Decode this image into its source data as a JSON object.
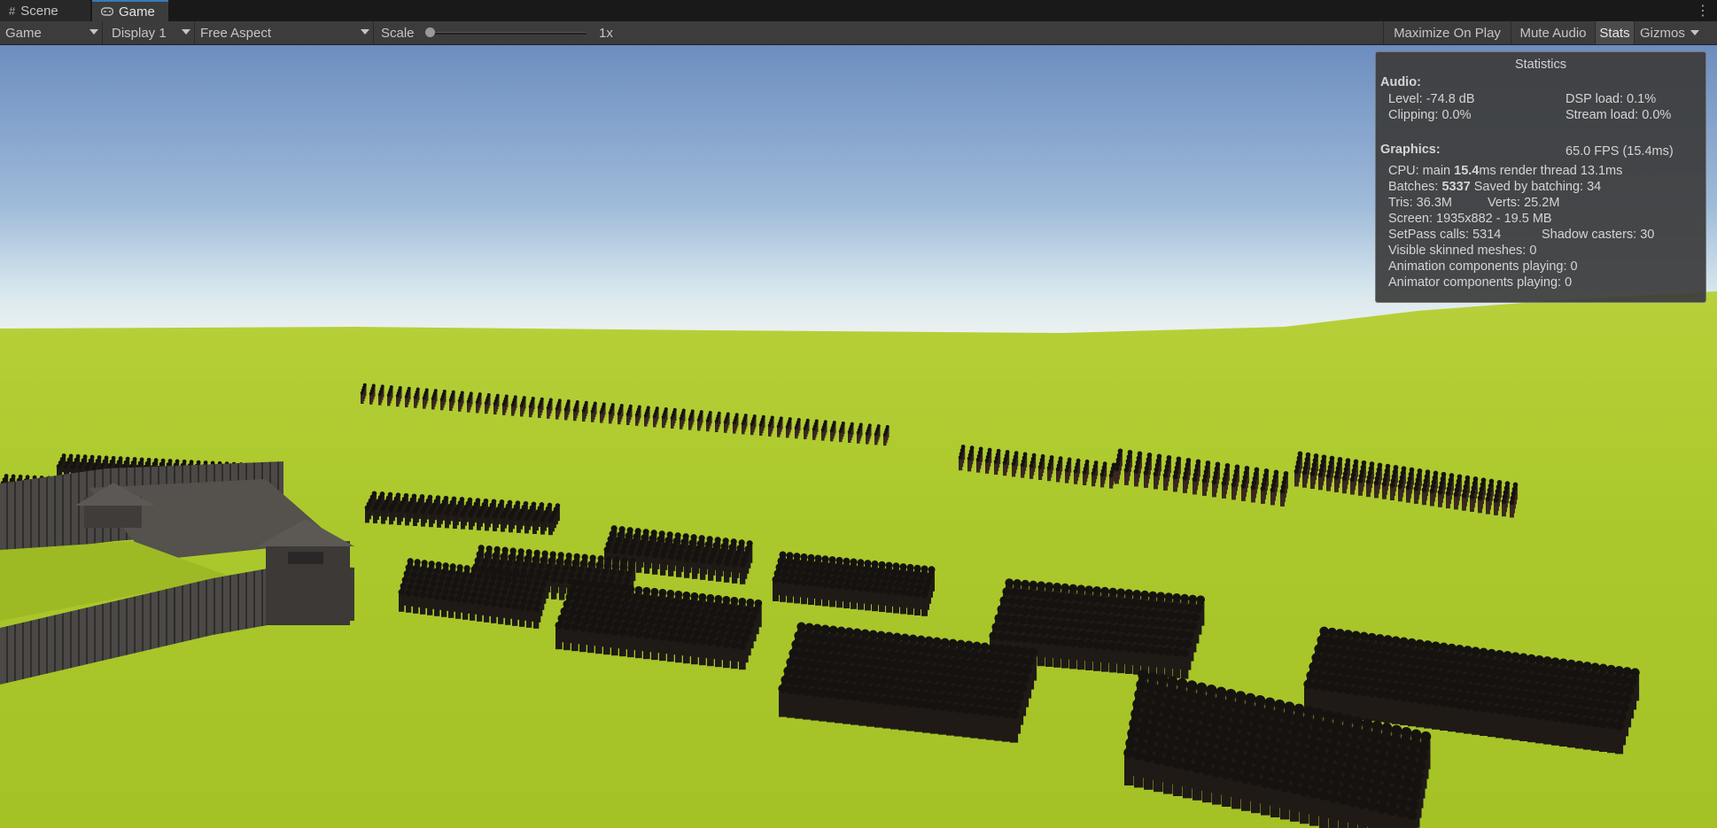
{
  "tabs": [
    {
      "label": "Scene",
      "icon": "grid-icon"
    },
    {
      "label": "Game",
      "icon": "gamepad-icon"
    }
  ],
  "toolbar": {
    "mode": "Game",
    "display": "Display 1",
    "aspect": "Free Aspect",
    "scale_label": "Scale",
    "scale_value": "1x",
    "scale_fraction": 0.0,
    "maximize": "Maximize On Play",
    "mute": "Mute Audio",
    "stats": "Stats",
    "gizmos": "Gizmos"
  },
  "stats": {
    "title": "Statistics",
    "audio_header": "Audio:",
    "level": "Level: -74.8 dB",
    "dsp": "DSP load: 0.1%",
    "clipping": "Clipping: 0.0%",
    "stream": "Stream load: 0.0%",
    "graphics_header": "Graphics:",
    "fps": "65.0 FPS (15.4ms)",
    "cpu_prefix": "CPU: main ",
    "cpu_main": "15.4",
    "cpu_suffix": "ms  render thread 13.1ms",
    "batches_prefix": "Batches: ",
    "batches": "5337",
    "batches_suffix": "  Saved by batching: 34",
    "tris": "Tris: 36.3M",
    "verts": "Verts: 25.2M",
    "screen": "Screen: 1935x882 - 19.5 MB",
    "setpass": "SetPass calls: 5314",
    "shadow": "Shadow casters: 30",
    "skinned": "Visible skinned meshes: 0",
    "animation": "Animation components playing: 0",
    "animator": "Animator components playing: 0"
  },
  "scene": {
    "sky_top": "#6c8dbf",
    "sky_horizon": "#eef2f0",
    "grass_near": "#a9c72a",
    "grass_far": "#b5cf35",
    "unit_color": "#1f1a16",
    "fort_color": "#4a4744"
  }
}
